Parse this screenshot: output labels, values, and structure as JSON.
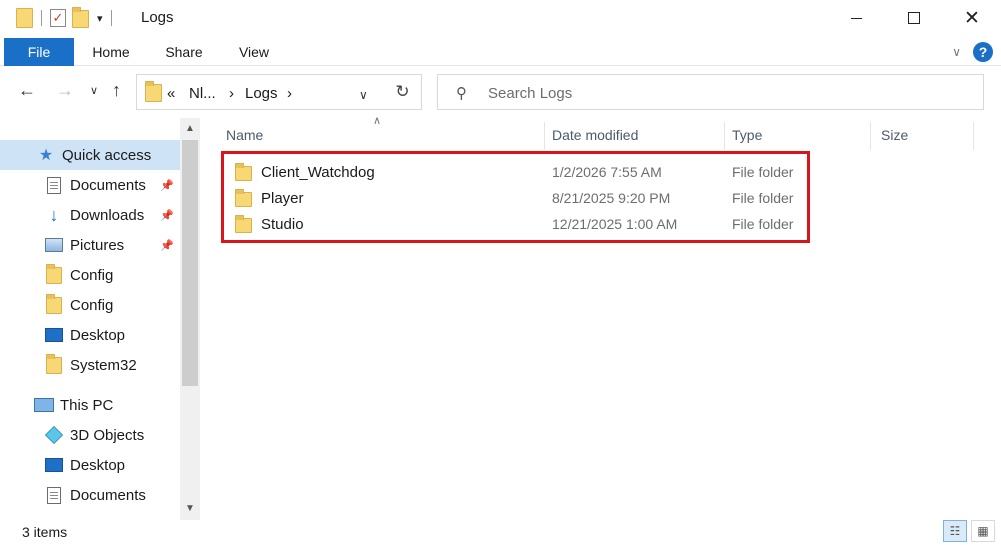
{
  "window": {
    "title": "Logs"
  },
  "ribbon": {
    "tabs": [
      "File",
      "Home",
      "Share",
      "View"
    ],
    "help_label": "?"
  },
  "address": {
    "crumb_more": "«",
    "crumb_parent": "Nl...",
    "crumb_current": "Logs",
    "separator": "›"
  },
  "search": {
    "placeholder": "Search Logs"
  },
  "nav": {
    "items": [
      {
        "label": "Quick access",
        "icon": "star-icon"
      },
      {
        "label": "Documents",
        "icon": "documents-icon",
        "pinned": true
      },
      {
        "label": "Downloads",
        "icon": "downloads-icon",
        "pinned": true
      },
      {
        "label": "Pictures",
        "icon": "pictures-icon",
        "pinned": true
      },
      {
        "label": "Config",
        "icon": "folder-icon"
      },
      {
        "label": "Config",
        "icon": "folder-icon"
      },
      {
        "label": "Desktop",
        "icon": "desktop-icon"
      },
      {
        "label": "System32",
        "icon": "folder-icon"
      },
      {
        "label": "This PC",
        "icon": "pc-icon"
      },
      {
        "label": "3D Objects",
        "icon": "3d-objects-icon"
      },
      {
        "label": "Desktop",
        "icon": "desktop-icon"
      },
      {
        "label": "Documents",
        "icon": "documents-icon"
      }
    ]
  },
  "columns": {
    "name": "Name",
    "date": "Date modified",
    "type": "Type",
    "size": "Size"
  },
  "files": [
    {
      "name": "Client_Watchdog",
      "date": "1/2/2026 7:55 AM",
      "type": "File folder"
    },
    {
      "name": "Player",
      "date": "8/21/2025 9:20 PM",
      "type": "File folder"
    },
    {
      "name": "Studio",
      "date": "12/21/2025 1:00 AM",
      "type": "File folder"
    }
  ],
  "status": {
    "count": "3 items"
  },
  "colors": {
    "accent": "#1a6fc6",
    "highlight_border": "#d8141c",
    "selected_bg": "#cfe3f7"
  }
}
